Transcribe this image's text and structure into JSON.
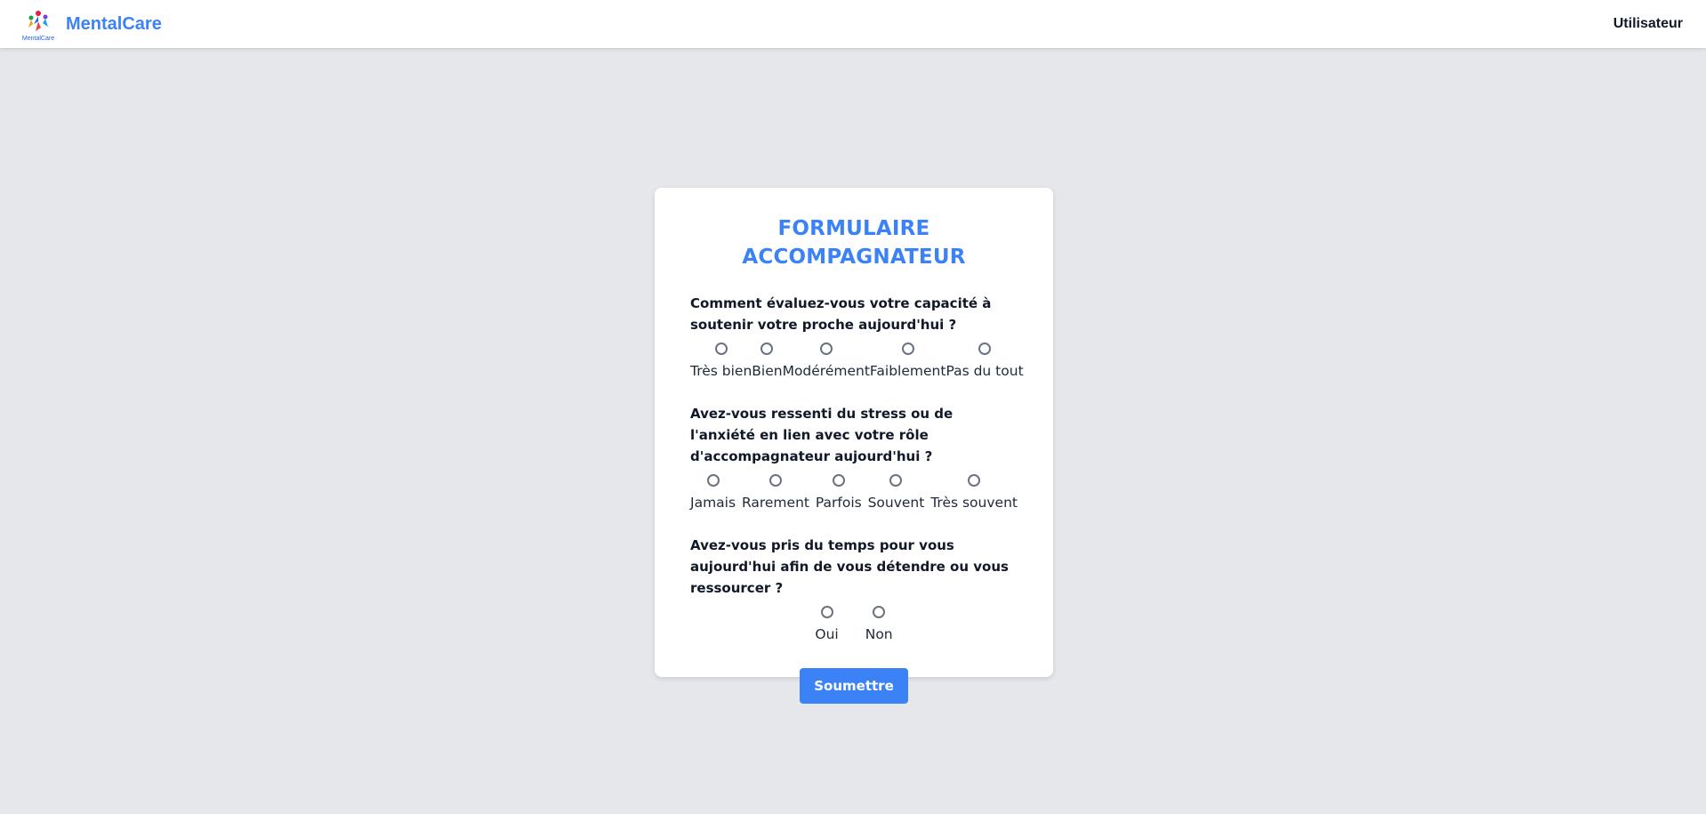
{
  "header": {
    "logo_text": "MentalCare",
    "brand_name": "MentalCare",
    "user_label": "Utilisateur"
  },
  "form": {
    "title_line1": "FORMULAIRE",
    "title_line2": "ACCOMPAGNATEUR",
    "questions": [
      {
        "text": "Comment évaluez-vous votre capacité à soutenir votre proche aujourd'hui ?",
        "options": [
          "Très bien",
          "Bien",
          "Modérément",
          "Faiblement",
          "Pas du tout"
        ]
      },
      {
        "text": "Avez-vous ressenti du stress ou de l'anxiété en lien avec votre rôle d'accompagnateur aujourd'hui ?",
        "options": [
          "Jamais",
          "Rarement",
          "Parfois",
          "Souvent",
          "Très souvent"
        ]
      },
      {
        "text": "Avez-vous pris du temps pour vous aujourd'hui afin de vous détendre ou vous ressourcer ?",
        "options": [
          "Oui",
          "Non"
        ]
      }
    ],
    "submit_label": "Soumettre"
  },
  "colors": {
    "accent": "#3b82f6",
    "background": "#e5e7eb",
    "card": "#ffffff"
  }
}
